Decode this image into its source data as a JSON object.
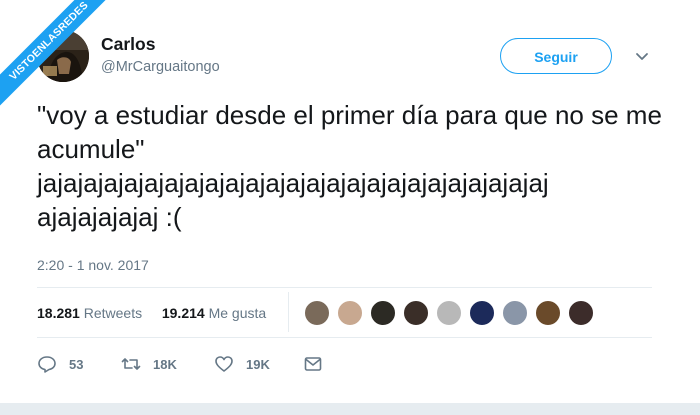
{
  "watermark": {
    "text": "VISTOENLASREDES"
  },
  "user": {
    "name": "Carlos",
    "handle": "@MrCarguaitongo"
  },
  "follow_label": "Seguir",
  "tweet": {
    "text": "\"voy a estudiar desde el primer día para que no se me acumule\" jajajajajajajajajajajajajajajajajajajajajajajajajaj ajajajajajaj :("
  },
  "timestamp": "2:20 - 1 nov. 2017",
  "stats": {
    "retweets_count": "18.281",
    "retweets_label": "Retweets",
    "likes_count": "19.214",
    "likes_label": "Me gusta"
  },
  "actions": {
    "replies": "53",
    "retweets": "18K",
    "likes": "19K"
  },
  "colors": {
    "accent": "#1da1f2",
    "text": "#14171a",
    "muted": "#657786",
    "divider": "#e6ecf0"
  },
  "icons": [
    "reply-icon",
    "retweet-icon",
    "heart-icon",
    "message-icon",
    "chevron-down-icon"
  ]
}
